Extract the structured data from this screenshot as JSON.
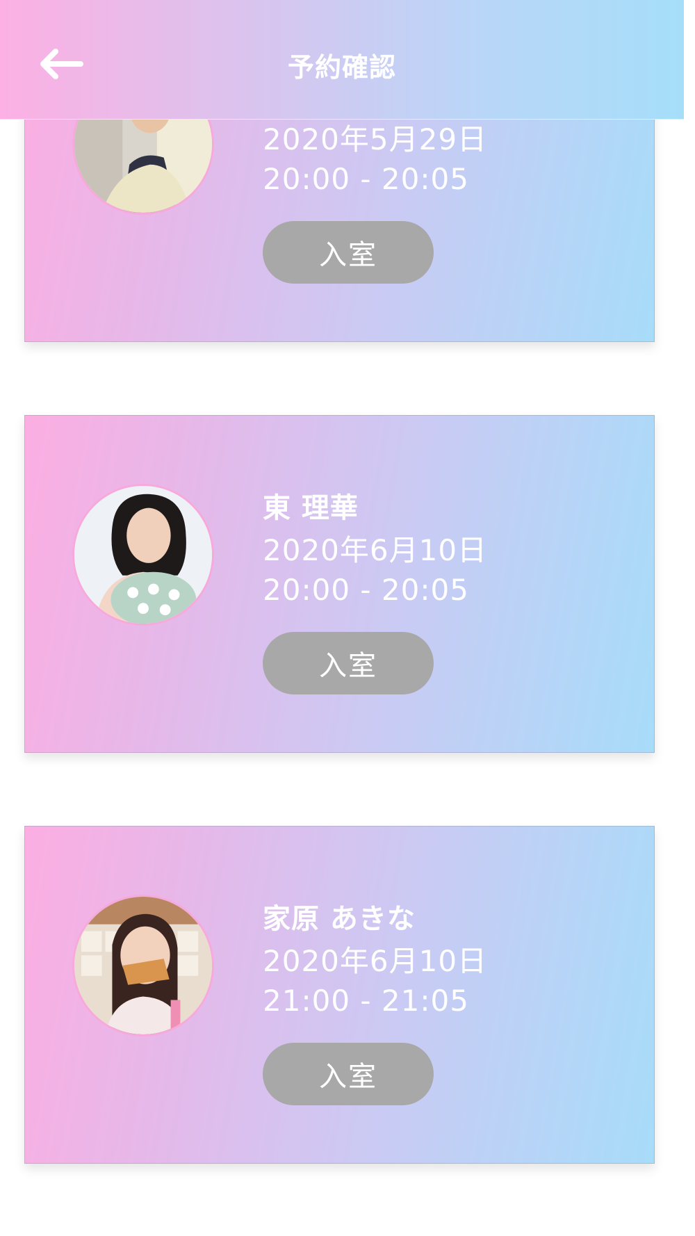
{
  "header": {
    "title": "予約確認",
    "back_icon": "arrow-left-icon"
  },
  "colors": {
    "gradient_pink": "#fcaee2",
    "gradient_blue": "#a7dcf9",
    "button_gray": "#a8a8a8",
    "avatar_border": "#f7a9dc"
  },
  "reservations": [
    {
      "name": "",
      "date": "2020年5月29日",
      "time": "20:00 - 20:05",
      "button_label": "入室"
    },
    {
      "name": "東 理華",
      "date": "2020年6月10日",
      "time": "20:00 - 20:05",
      "button_label": "入室"
    },
    {
      "name": "家原 あきな",
      "date": "2020年6月10日",
      "time": "21:00 - 21:05",
      "button_label": "入室"
    }
  ]
}
